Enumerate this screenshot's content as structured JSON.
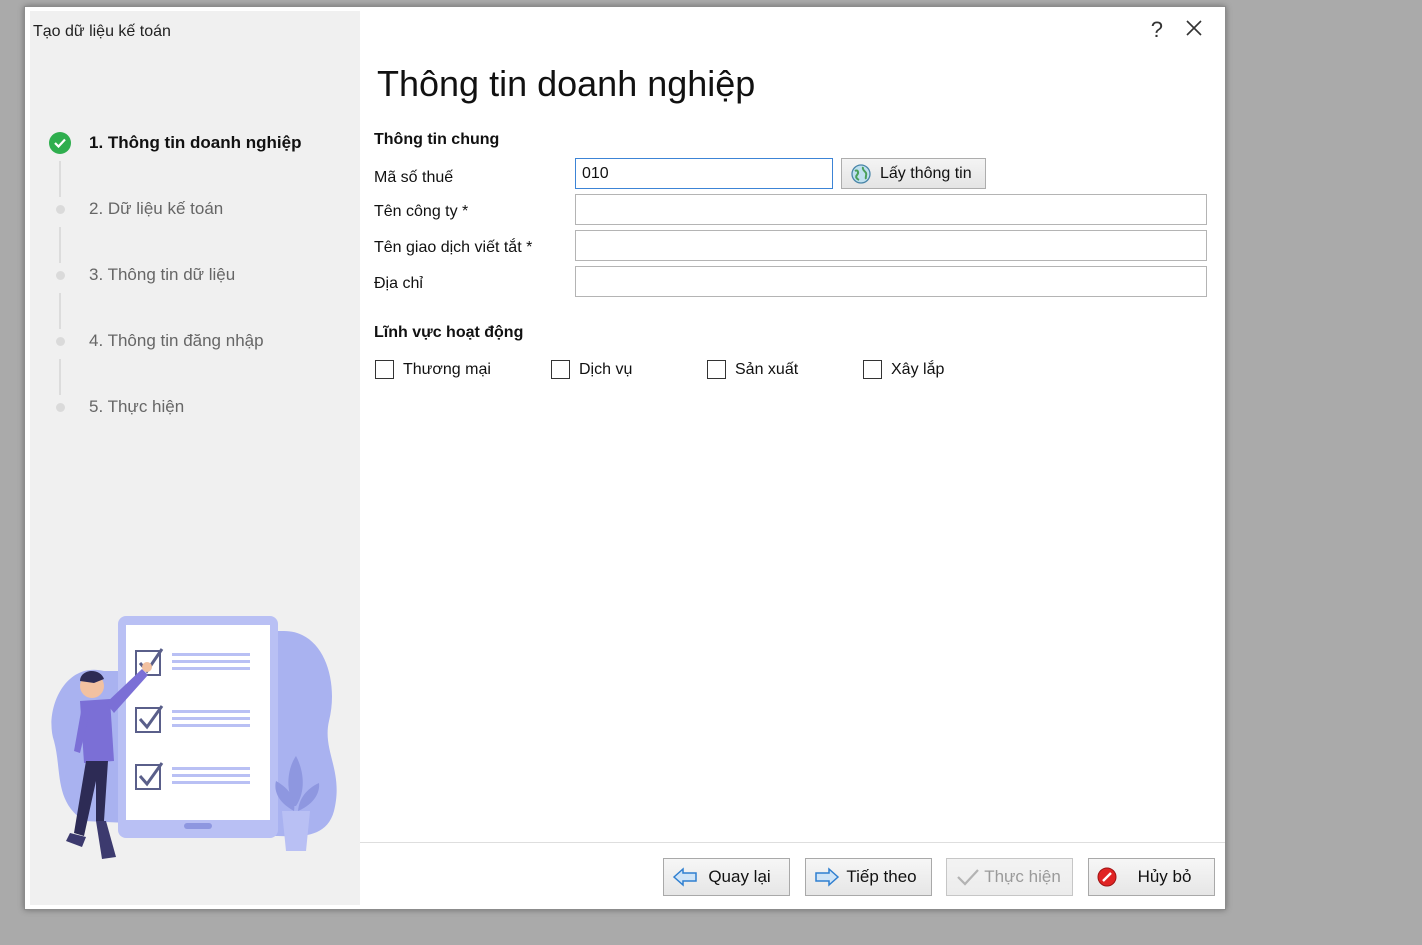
{
  "window": {
    "title": "Tạo dữ liệu kế toán",
    "help": "?"
  },
  "steps": [
    {
      "label": "1. Thông tin doanh nghiệp",
      "state": "done"
    },
    {
      "label": "2. Dữ liệu kế toán",
      "state": "pending"
    },
    {
      "label": "3. Thông tin dữ liệu",
      "state": "pending"
    },
    {
      "label": "4. Thông tin đăng nhập",
      "state": "pending"
    },
    {
      "label": "5. Thực hiện",
      "state": "pending"
    }
  ],
  "page": {
    "title": "Thông tin doanh nghiệp",
    "general_section": "Thông tin chung",
    "fields": {
      "tax_code": {
        "label": "Mã số thuế",
        "value": "010"
      },
      "company_name": {
        "label": "Tên công ty *",
        "value": ""
      },
      "short_name": {
        "label": "Tên giao dịch viết tắt *",
        "value": ""
      },
      "address": {
        "label": "Địa chỉ",
        "value": ""
      }
    },
    "get_info_button": "Lấy thông tin",
    "activity_section": "Lĩnh vực hoạt động",
    "activities": [
      {
        "label": "Thương mại",
        "checked": false
      },
      {
        "label": "Dịch vụ",
        "checked": false
      },
      {
        "label": "Sản xuất",
        "checked": false
      },
      {
        "label": "Xây lắp",
        "checked": false
      }
    ]
  },
  "footer": {
    "back": "Quay lại",
    "next": "Tiếp theo",
    "execute": "Thực hiện",
    "cancel": "Hủy bỏ"
  },
  "colors": {
    "accent": "#3c84d6",
    "success": "#2fae4e",
    "illustration": "#a9b2f0",
    "cancel": "#e02424"
  }
}
